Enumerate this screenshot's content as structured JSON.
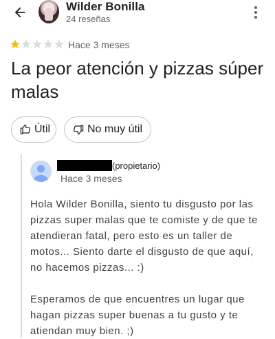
{
  "header": {
    "user_name": "Wilder Bonilla",
    "review_count": "24 reseñas",
    "back_icon": "arrow-back-icon",
    "more_icon": "more-vert-icon"
  },
  "review": {
    "rating": 1,
    "rating_max": 5,
    "time": "Hace 3 meses",
    "title": "La peor atención y pizzas súper malas"
  },
  "actions": {
    "helpful_label": "Útil",
    "not_helpful_label": "No muy útil"
  },
  "reply": {
    "owner_tag": "(propietario)",
    "time": "Hace 3 meses",
    "paragraph_1": "Hola Wilder Bonilla, siento tu disgusto por las pizzas super malas que te comiste y de que te atendieran fatal, pero esto es un taller de motos... Siento darte el disgusto de que aquí, no hacemos pizzas... :)",
    "paragraph_2": "Esperamos de que encuentres un lugar que hagan pizzas super buenas a tu gusto y te atiendan muy bien. ;)"
  },
  "colors": {
    "star_filled": "#fbbc04",
    "star_empty": "#dadce0",
    "text_primary": "#202124",
    "text_secondary": "#5f6368"
  }
}
